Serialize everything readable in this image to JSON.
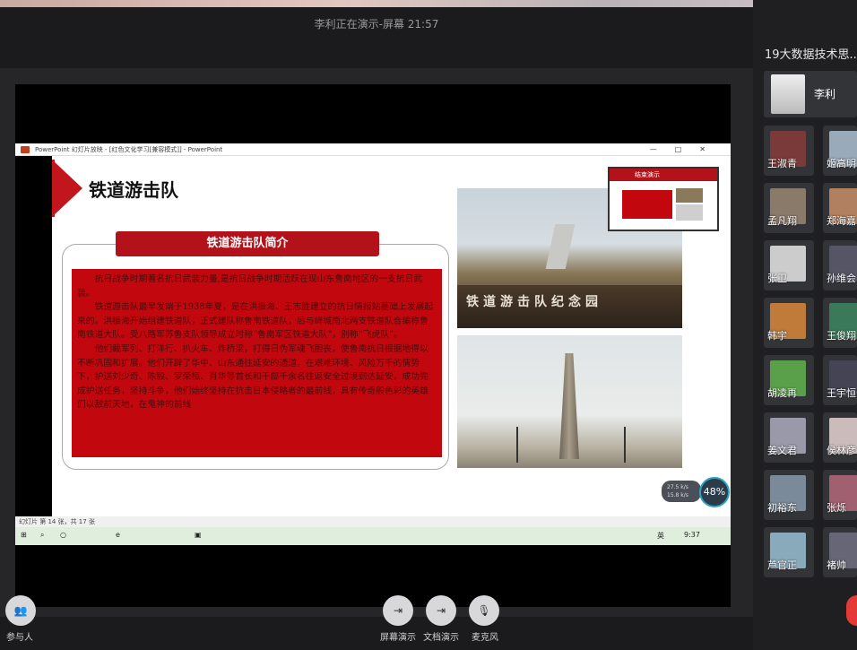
{
  "window": {
    "title": "李利正在演示-屏幕 21:57"
  },
  "ppt": {
    "window_title": "PowerPoint 幻灯片放映 - [红色文化学习[兼容模式]] - PowerPoint",
    "status": "幻灯片 第 14 张，共 17 张",
    "tray_time": "9:37",
    "tray_lang": "英"
  },
  "slide": {
    "title": "铁道游击队",
    "subtitle": "铁道游击队简介",
    "para1": "抗日战争时期著名抗日武装力量,是抗日战争时期活跃在现山东鲁南地区的一支抗日武装。",
    "para2": "铁道游击队最早发端于1938年夏，是在洪振海、王志胜建立的抗日情报站基础上发展起来的。洪振海开始组建铁道队，正式建队称鲁南铁道队，后与峄城南北两支铁道队合编称鲁南铁道大队。受八路军苏鲁支队领导成立时称“鲁南军区铁道大队”，别称“飞虎队”。",
    "para3": "他们截军列、打洋行、扒火车、炸桥梁，打得日伪军魂飞胆丧，使鲁南抗日根据地得以不断巩固和扩展。他们开辟了华中、山东通往延安的通道，在艰难环境、风险万千的情势下，护送刘少奇、陈毅、罗荣桓、肖华等首长和干部千余名往返安全过境到达延安，成功完成护送任务，坚持斗争，他们始终坚持在抗击日本侵略者的最前线，具有传奇般色彩的英雄们以敌前天地，在鬼神的前线",
    "photo1_text": "铁道游击队纪念园",
    "preview_label": "结束演示"
  },
  "network": {
    "up": "27.5 k/s",
    "down": "15.8 k/s",
    "percent": "48%"
  },
  "sidebar": {
    "group": "19大数据技术思...",
    "host": "李利",
    "participants": [
      "王淑青",
      "姬高明",
      "孟凡翔",
      "郑海嘉",
      "张卫",
      "孙维会",
      "韩宇",
      "王俊翔",
      "胡凌再",
      "王宇恒",
      "姜文君",
      "侯林彦",
      "初裕东",
      "张烁",
      "芦官正",
      "褚帅"
    ]
  },
  "bottom": {
    "participants_label": "参与人",
    "screen_share_label": "屏幕演示",
    "doc_share_label": "文档演示",
    "mic_label": "麦克风"
  }
}
